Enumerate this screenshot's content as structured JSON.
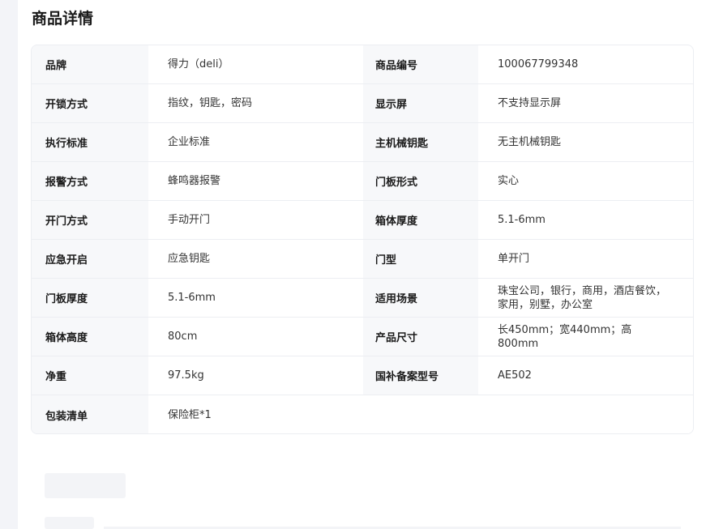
{
  "section": {
    "title": "商品详情"
  },
  "specs": {
    "r0": {
      "l1": "品牌",
      "v1": "得力（deli）",
      "l2": "商品编号",
      "v2": "100067799348"
    },
    "r1": {
      "l1": "开锁方式",
      "v1": "指纹，钥匙，密码",
      "l2": "显示屏",
      "v2": "不支持显示屏"
    },
    "r2": {
      "l1": "执行标准",
      "v1": "企业标准",
      "l2": "主机械钥匙",
      "v2": "无主机械钥匙"
    },
    "r3": {
      "l1": "报警方式",
      "v1": "蜂鸣器报警",
      "l2": "门板形式",
      "v2": "实心"
    },
    "r4": {
      "l1": "开门方式",
      "v1": "手动开门",
      "l2": "箱体厚度",
      "v2": "5.1-6mm"
    },
    "r5": {
      "l1": "应急开启",
      "v1": "应急钥匙",
      "l2": "门型",
      "v2": "单开门"
    },
    "r6": {
      "l1": "门板厚度",
      "v1": "5.1-6mm",
      "l2": "适用场景",
      "v2": "珠宝公司，银行，商用，酒店餐饮，家用，别墅，办公室"
    },
    "r7": {
      "l1": "箱体高度",
      "v1": "80cm",
      "l2": "产品尺寸",
      "v2": "长450mm；宽440mm；高800mm"
    },
    "r8": {
      "l1": "净重",
      "v1": "97.5kg",
      "l2": "国补备案型号",
      "v2": "AE502"
    },
    "r9": {
      "l1": "包装清单",
      "v1": "保险柜*1"
    }
  }
}
